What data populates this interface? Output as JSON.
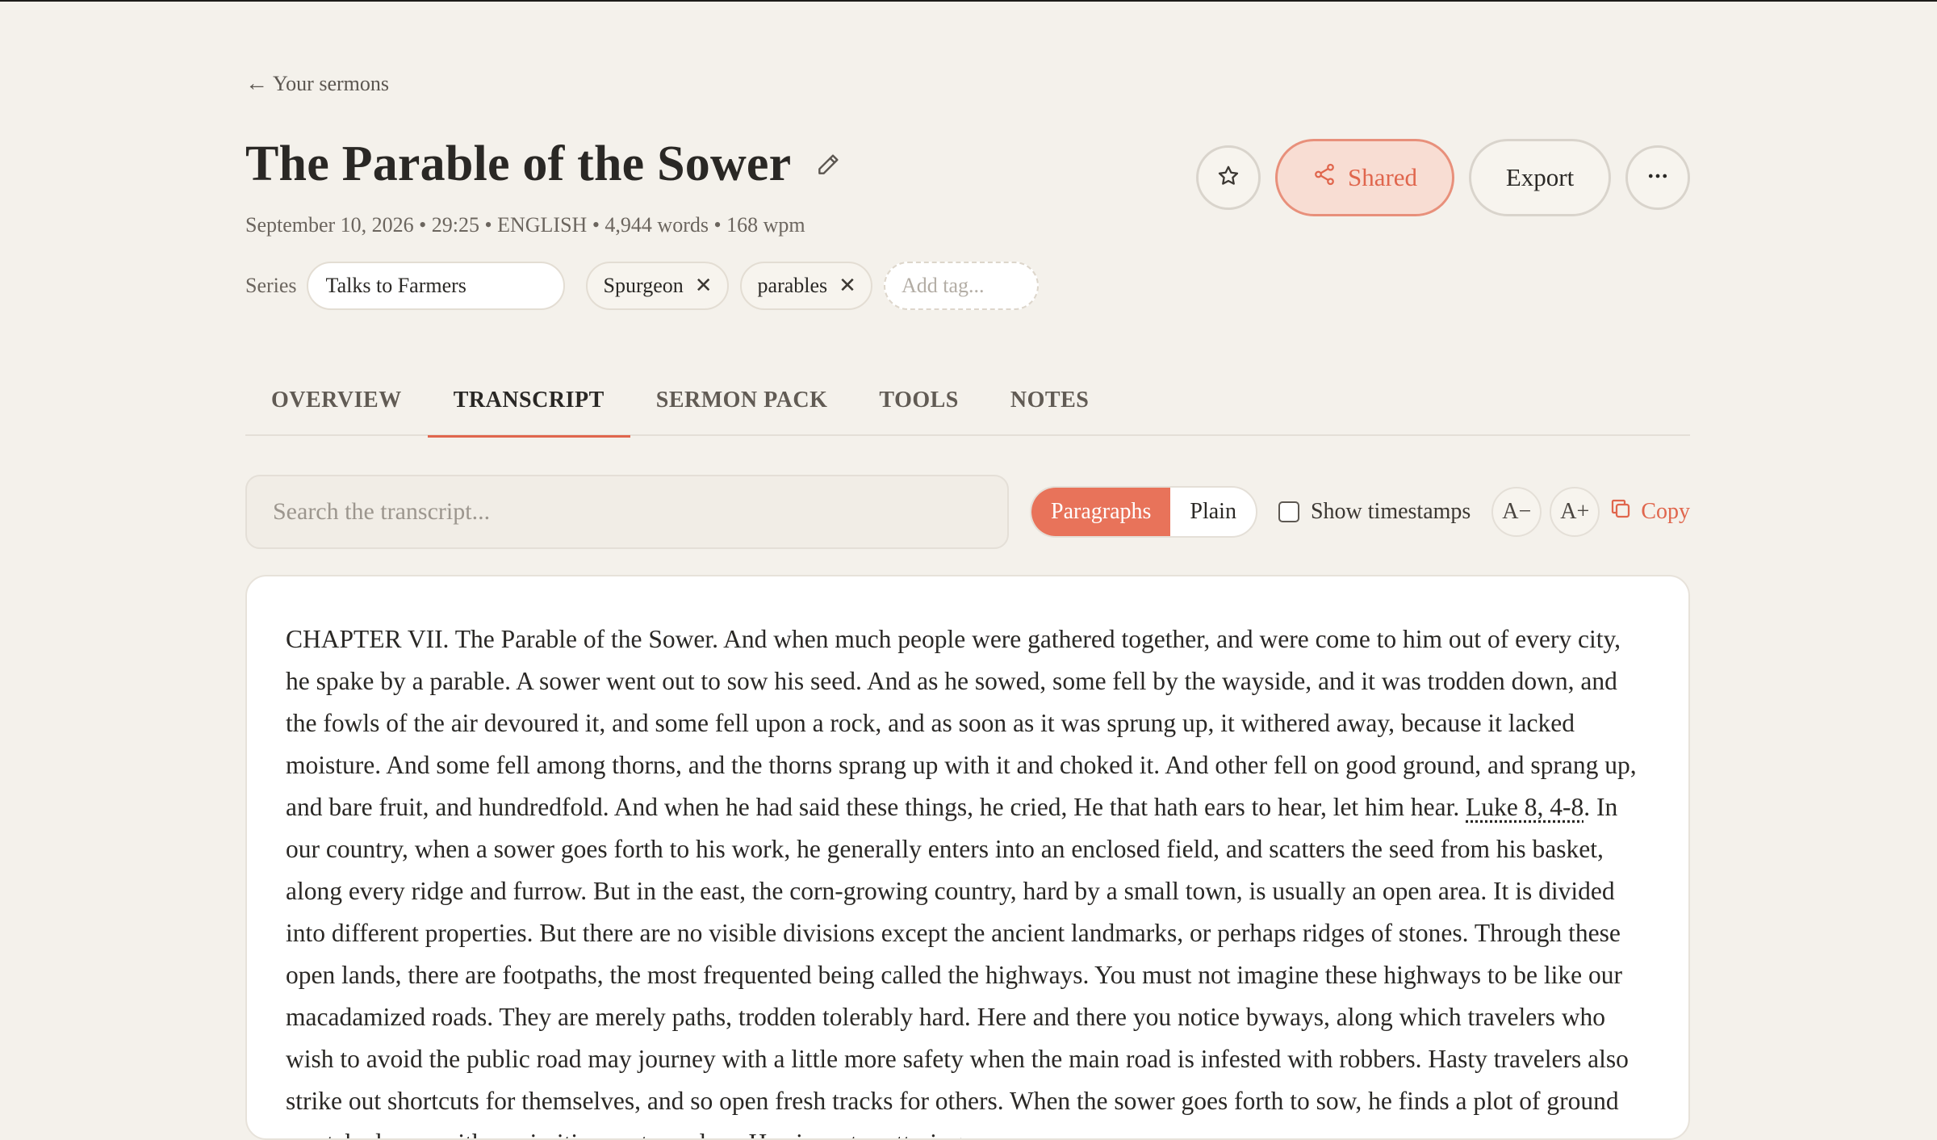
{
  "nav": {
    "back_label": "Your sermons"
  },
  "sermon": {
    "title": "The Parable of the Sower",
    "meta": "September 10, 2026 • 29:25 • ENGLISH • 4,944 words • 168 wpm",
    "series_label": "Series",
    "series_value": "Talks to Farmers",
    "tags": [
      "Spurgeon",
      "parables"
    ],
    "add_tag_placeholder": "Add tag..."
  },
  "actions": {
    "shared_label": "Shared",
    "export_label": "Export"
  },
  "tabs": [
    {
      "label": "OVERVIEW",
      "active": false
    },
    {
      "label": "TRANSCRIPT",
      "active": true
    },
    {
      "label": "SERMON PACK",
      "active": false
    },
    {
      "label": "TOOLS",
      "active": false
    },
    {
      "label": "NOTES",
      "active": false
    }
  ],
  "toolbar": {
    "search_placeholder": "Search the transcript...",
    "view_modes": [
      "Paragraphs",
      "Plain"
    ],
    "selected_view": "Paragraphs",
    "timestamps_label": "Show timestamps",
    "timestamps_checked": false,
    "font_smaller": "A−",
    "font_larger": "A+",
    "copy_label": "Copy"
  },
  "transcript": {
    "before_ref": "CHAPTER VII. The Parable of the Sower. And when much people were gathered together, and were come to him out of every city, he spake by a parable. A sower went out to sow his seed. And as he sowed, some fell by the wayside, and it was trodden down, and the fowls of the air devoured it, and some fell upon a rock, and as soon as it was sprung up, it withered away, because it lacked moisture. And some fell among thorns, and the thorns sprang up with it and choked it. And other fell on good ground, and sprang up, and bare fruit, and hundredfold. And when he had said these things, he cried, He that hath ears to hear, let him hear. ",
    "scripture_ref": "Luke 8, 4-8",
    "after_ref": ". In our country, when a sower goes forth to his work, he generally enters into an enclosed field, and scatters the seed from his basket, along every ridge and furrow. But in the east, the corn-growing country, hard by a small town, is usually an open area. It is divided into different properties. But there are no visible divisions except the ancient landmarks, or perhaps ridges of stones. Through these open lands, there are footpaths, the most frequented being called the highways. You must not imagine these highways to be like our macadamized roads. They are merely paths, trodden tolerably hard. Here and there you notice byways, along which travelers who wish to avoid the public road may journey with a little more safety when the main road is infested with robbers. Hasty travelers also strike out shortcuts for themselves, and so open fresh tracks for others. When the sower goes forth to sow, he finds a plot of ground scratched over with a primitive eastern plow. He aims at scattering"
  },
  "colors": {
    "accent": "#e8735a",
    "accent_text": "#e0664d",
    "shared_bg": "#f8ddd3",
    "background": "#f4f1eb",
    "panel": "#ffffff"
  },
  "icons": {
    "back": "arrow-left-icon",
    "edit": "pencil-icon",
    "favorite": "star-icon",
    "share": "share-icon",
    "more": "more-horizontal-icon",
    "remove_tag": "close-icon",
    "copy": "copy-icon"
  }
}
